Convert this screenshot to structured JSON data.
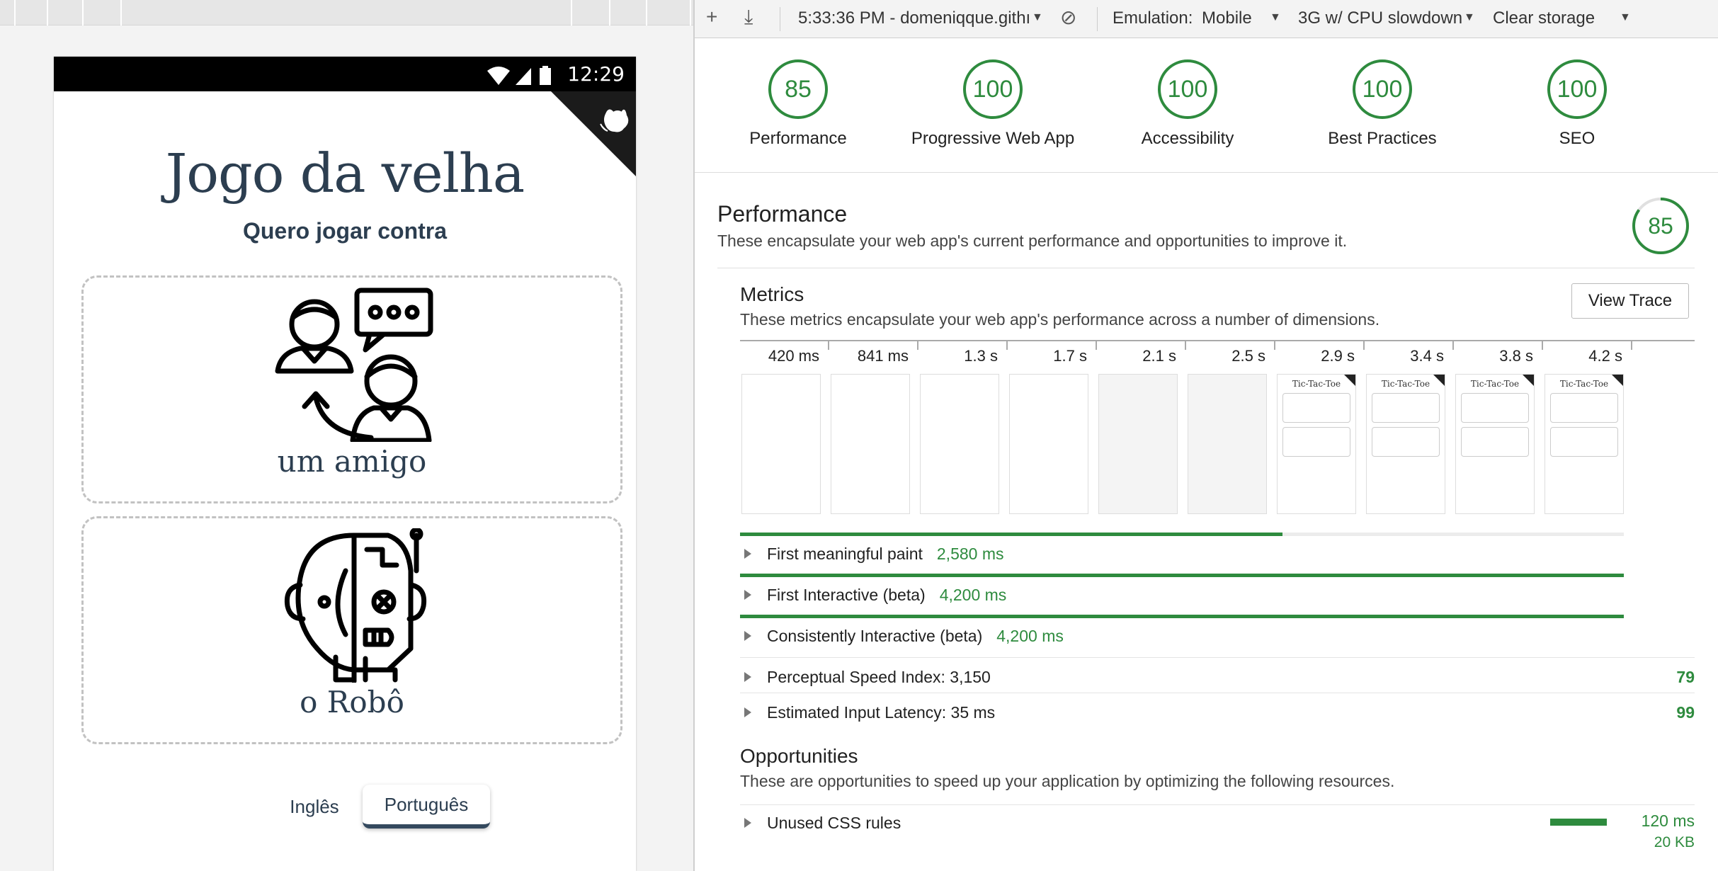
{
  "device": {
    "status_time": "12:29",
    "app_title": "Jogo da velha",
    "app_subtitle": "Quero jogar contra",
    "option_friend": "um amigo",
    "option_robot": "o Robô",
    "lang_en": "Inglês",
    "lang_pt": "Português"
  },
  "toolbar": {
    "report_select": "5:33:36 PM - domeniqque.githı",
    "emulation_label": "Emulation:",
    "emulation_value": "Mobile",
    "throttle_value": "3G w/ CPU slowdown",
    "storage_value": "Clear storage"
  },
  "scores": [
    {
      "label": "Performance",
      "value": "85"
    },
    {
      "label": "Progressive Web App",
      "value": "100"
    },
    {
      "label": "Accessibility",
      "value": "100"
    },
    {
      "label": "Best Practices",
      "value": "100"
    },
    {
      "label": "SEO",
      "value": "100"
    }
  ],
  "performance": {
    "title": "Performance",
    "description": "These encapsulate your web app's current performance and opportunities to improve it.",
    "score": "85"
  },
  "metrics": {
    "title": "Metrics",
    "description": "These metrics encapsulate your web app's performance across a number of dimensions.",
    "view_trace": "View Trace",
    "filmstrip": [
      {
        "time": "420 ms",
        "state": "blank"
      },
      {
        "time": "841 ms",
        "state": "blank"
      },
      {
        "time": "1.3 s",
        "state": "blank"
      },
      {
        "time": "1.7 s",
        "state": "blank"
      },
      {
        "time": "2.1 s",
        "state": "loading"
      },
      {
        "time": "2.5 s",
        "state": "loading"
      },
      {
        "time": "2.9 s",
        "state": "rendered"
      },
      {
        "time": "3.4 s",
        "state": "rendered"
      },
      {
        "time": "3.8 s",
        "state": "rendered"
      },
      {
        "time": "4.2 s",
        "state": "full"
      }
    ],
    "thumb_title": "Tic-Tac-Toe",
    "rows": [
      {
        "label": "First meaningful paint",
        "value": "2,580 ms",
        "fraction": 0.614,
        "score": ""
      },
      {
        "label": "First Interactive (beta)",
        "value": "4,200 ms",
        "fraction": 1.0,
        "score": ""
      },
      {
        "label": "Consistently Interactive (beta)",
        "value": "4,200 ms",
        "fraction": 1.0,
        "score": ""
      },
      {
        "label": "Perceptual Speed Index: 3,150",
        "value": "",
        "fraction": null,
        "score": "79"
      },
      {
        "label": "Estimated Input Latency: 35 ms",
        "value": "",
        "fraction": null,
        "score": "99"
      }
    ]
  },
  "opportunities": {
    "title": "Opportunities",
    "description": "These are opportunities to speed up your application by optimizing the following resources.",
    "items": [
      {
        "label": "Unused CSS rules",
        "time": "120 ms",
        "size": "20 KB"
      }
    ]
  },
  "colors": {
    "pass": "#2e8b3e",
    "app_text": "#2c3e50"
  }
}
